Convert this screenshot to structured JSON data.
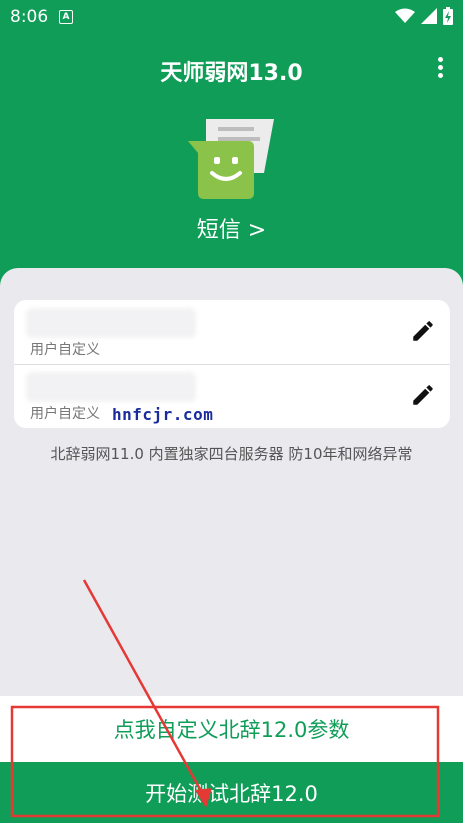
{
  "status_bar": {
    "time": "8:06",
    "notification_badge": "A"
  },
  "app_bar": {
    "title": "天师弱网13.0"
  },
  "hero": {
    "link_label": "短信 >"
  },
  "list": {
    "items": [
      {
        "subtitle": "用户自定义"
      },
      {
        "subtitle": "用户自定义"
      }
    ]
  },
  "watermark": "hnfcjr.com",
  "notice": "北辞弱网11.0 内置独家四台服务器 防10年和网络异常",
  "buttons": {
    "customize_label": "点我自定义北辞12.0参数",
    "start_label": "开始测试北辞12.0"
  },
  "colors": {
    "primary": "#0f9d58",
    "background": "#e9e9ee",
    "annotation": "#e53935"
  }
}
